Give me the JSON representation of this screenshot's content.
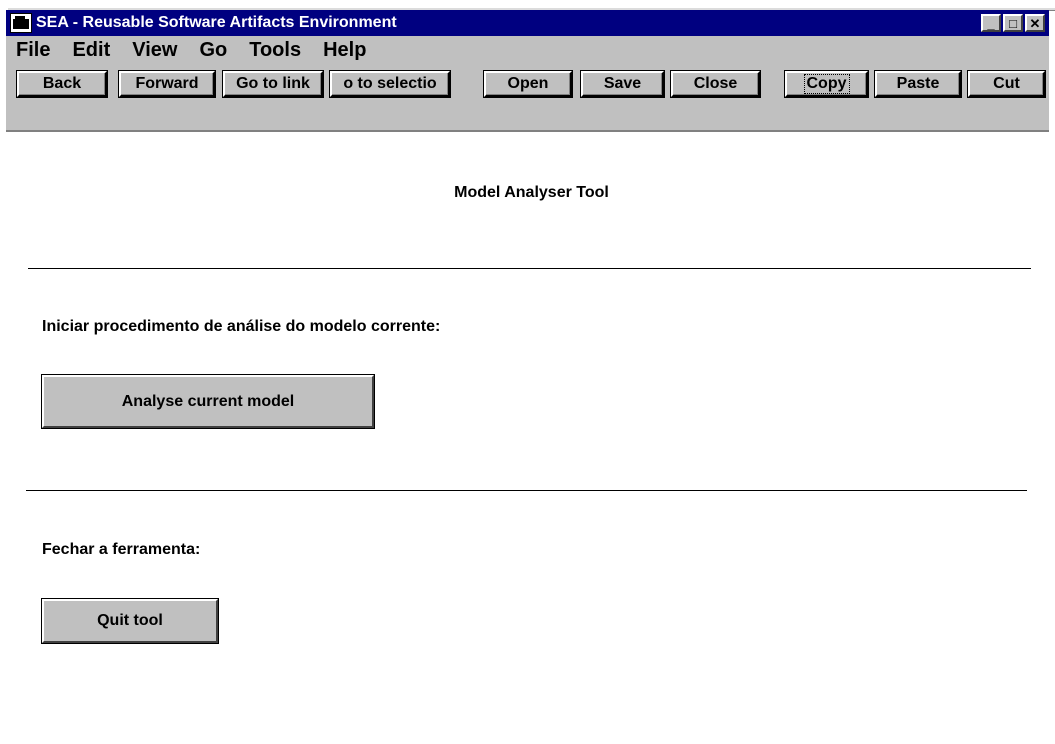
{
  "window": {
    "title": "SEA - Reusable Software Artifacts Environment",
    "controls": {
      "minimize": "_",
      "maximize": "□",
      "close": "✕"
    }
  },
  "menu": [
    "File",
    "Edit",
    "View",
    "Go",
    "Tools",
    "Help"
  ],
  "toolbar": {
    "back": "Back",
    "forward": "Forward",
    "go_to_link": "Go to link",
    "go_to_selection": "o to selectio",
    "open": "Open",
    "save": "Save",
    "close": "Close",
    "copy": "Copy",
    "paste": "Paste",
    "cut": "Cut"
  },
  "content": {
    "title": "Model Analyser Tool",
    "analyse_prompt": "Iniciar procedimento de análise do modelo corrente:",
    "analyse_button": "Analyse current model",
    "quit_prompt": "Fechar a ferramenta:",
    "quit_button": "Quit tool"
  },
  "colors": {
    "titlebar": "#000080",
    "chrome": "#c0c0c0",
    "background": "#ffffff"
  },
  "icons": {
    "app": "app-window-icon"
  }
}
